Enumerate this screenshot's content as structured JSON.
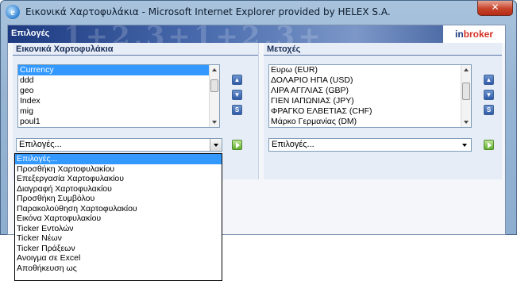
{
  "window": {
    "title": "Εικονικά Χαρτοφυλάκια - Microsoft Internet Explorer provided by HELEX S.A.",
    "close_glyph": "✕",
    "icon": "ie-icon"
  },
  "header": {
    "title": "Επιλογές",
    "brand_in": "in",
    "brand_broker": "broker",
    "watermark": "1+2,3+1+2,3+"
  },
  "portfolios": {
    "label": "Εικονικά Χαρτοφυλάκια",
    "items": [
      "Currency",
      "ddd",
      "geo",
      "Index",
      "mig",
      "poul1"
    ],
    "selected_index": 0,
    "actions_select": {
      "value": "Επιλογές..."
    }
  },
  "stocks": {
    "label": "Μετοχές",
    "items": [
      "Ευρω (EUR)",
      "ΔΟΛΑΡΙΟ ΗΠΑ (USD)",
      "ΛΙΡΑ ΑΓΓΛΙΑΣ (GBP)",
      "ΓΙΕΝ ΙΑΠΩΝΙΑΣ (JPY)",
      "ΦΡΑΓΚΟ ΕΛΒΕΤΙΑΣ (CHF)",
      "Μάρκο Γερμανίας (DM)"
    ],
    "actions_select": {
      "value": "Επιλογές..."
    }
  },
  "side_buttons": {
    "up": "▲",
    "down": "▼",
    "sort": "S"
  },
  "dropdown_options": [
    "Επιλογές...",
    "Προσθήκη Χαρτοφυλακίου",
    "Επεξεργασία Χαρτοφυλακίου",
    "Διαγραφή Χαρτοφυλακίου",
    "Προσθήκη Συμβόλου",
    "Παρακολούθηση Χαρτοφυλακίου",
    "Εικόνα Χαρτοφυλακίου",
    "Ticker Εντολών",
    "Ticker Νέων",
    "Ticker Πράξεων",
    "Ανοιγμα σε Excel",
    "Αποθήκευση ως"
  ],
  "dropdown_selected_index": 0,
  "colors": {
    "selection": "#3399ff",
    "header_dark": "#1d3a80",
    "brand_red": "#d23124",
    "go_green": "#5fae2e"
  }
}
